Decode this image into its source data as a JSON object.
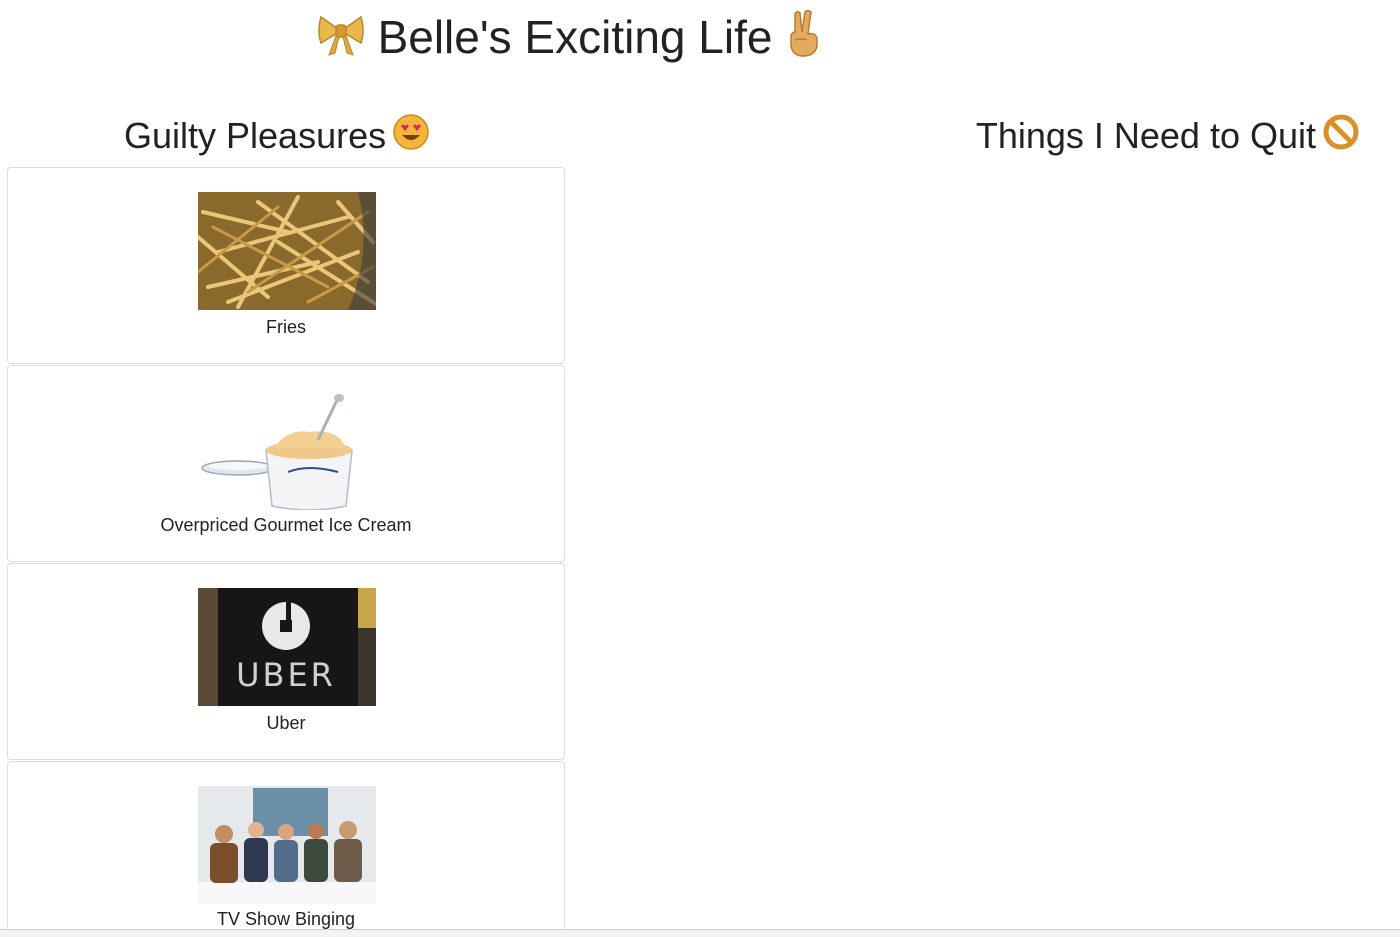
{
  "header": {
    "title": "Belle's Exciting Life"
  },
  "columns": {
    "left_title": "Guilty Pleasures",
    "right_title": "Things I Need to Quit"
  },
  "cards": [
    {
      "caption": "Fries",
      "image": "fries-photo"
    },
    {
      "caption": "Overpriced Gourmet Ice Cream",
      "image": "ice-cream-photo"
    },
    {
      "caption": "Uber",
      "image": "uber-logo-photo",
      "logo_text": "UBER"
    },
    {
      "caption": "TV Show Binging",
      "image": "tv-show-cast-photo"
    }
  ],
  "icons": {
    "title_left": "bow-icon",
    "title_right": "peace-hand-icon",
    "left_col": "heart-eyes-icon",
    "right_col": "prohibited-icon"
  },
  "colors": {
    "text": "#222222",
    "card_border": "#dcdcdc",
    "background": "#ffffff"
  }
}
